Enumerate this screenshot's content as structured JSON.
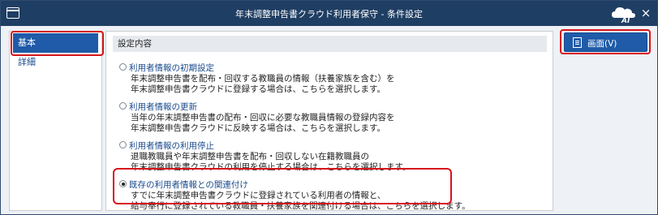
{
  "window": {
    "title": "年末調整申告書クラウド利用者保守 - 条件設定",
    "close_label": "×"
  },
  "sidebar": {
    "items": [
      {
        "label": "基本",
        "active": true
      },
      {
        "label": "詳細",
        "active": false
      }
    ]
  },
  "panel": {
    "header": "設定内容",
    "options": [
      {
        "title": "利用者情報の初期設定",
        "checked": false,
        "desc": [
          "年末調整申告書を配布・回収する教職員の情報（扶養家族を含む）を",
          "年末調整申告書クラウドに登録する場合は、こちらを選択します。"
        ]
      },
      {
        "title": "利用者情報の更新",
        "checked": false,
        "desc": [
          "当年の年末調整申告書の配布・回収に必要な教職員情報の登録内容を",
          "年末調整申告書クラウドに反映する場合は、こちらを選択します。"
        ]
      },
      {
        "title": "利用者情報の利用停止",
        "checked": false,
        "desc": [
          "退職教職員や年末調整申告書を配布・回収しない在籍教職員の",
          "年末調整申告書クラウドの利用を停止する場合は、こちらを選択します。"
        ]
      },
      {
        "title": "既存の利用者情報との関連付け",
        "checked": true,
        "desc": [
          "すでに年末調整申告書クラウドに登録されている利用者の情報と、",
          "給与奉行に登録されている教職員・扶養家族を関連付ける場合は、こちらを選択します。"
        ]
      }
    ]
  },
  "actions": {
    "screen_button_label": "画面(V)"
  },
  "colors": {
    "titlebar": "#1f3e63",
    "accent": "#1f5ba8",
    "highlight": "#d7141b",
    "link": "#1a4a8c"
  }
}
